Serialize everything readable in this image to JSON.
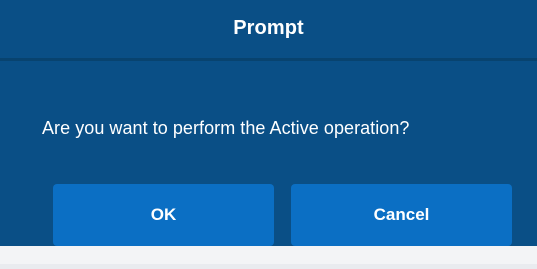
{
  "dialog": {
    "title": "Prompt",
    "message": "Are you want to perform the Active operation?",
    "buttons": {
      "ok_label": "OK",
      "cancel_label": "Cancel"
    }
  },
  "colors": {
    "dialog_background": "#0a4f86",
    "divider": "#08436f",
    "button_background": "#0b6fc4",
    "text": "#ffffff",
    "page_background": "#f3f4f6"
  }
}
